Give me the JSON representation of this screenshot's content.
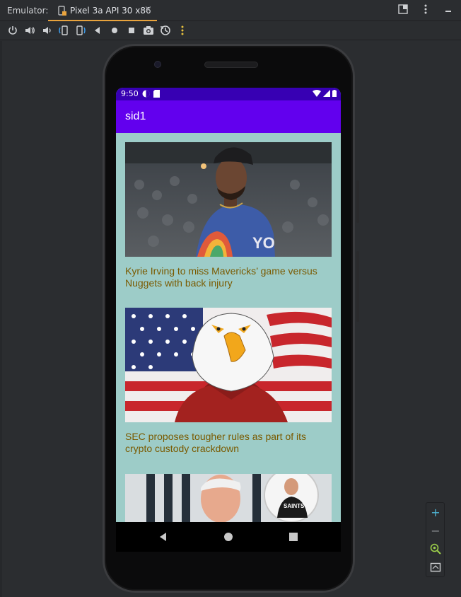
{
  "ide": {
    "emulator_label": "Emulator:",
    "tab_label": "Pixel 3a API 30 x86",
    "tab_close": "×",
    "accent_color": "#e8a33d"
  },
  "toolbar": {
    "icons": [
      "power-icon",
      "volume-up-icon",
      "volume-down-icon",
      "rotate-left-icon",
      "rotate-right-icon",
      "back-icon",
      "home-icon",
      "overview-icon",
      "screenshot-icon",
      "snapshot-icon",
      "more-icon"
    ]
  },
  "device": {
    "status_time": "9:50",
    "app_title": "sid1",
    "statusbar_color": "#3700b3",
    "appbar_color": "#6200ee",
    "background_color": "#9dccc8",
    "title_color": "#7a5a00"
  },
  "feed": {
    "items": [
      {
        "title": "Kyrie Irving to miss Mavericks’ game versus Nuggets with back injury",
        "image": "basketball-player-photo"
      },
      {
        "title": "SEC proposes tougher rules as part of its crypto custody crackdown",
        "image": "eagle-flag-illustration"
      },
      {
        "title": "",
        "image": "coach-photo"
      }
    ]
  },
  "zoom": {
    "plus": "+",
    "minus": "−"
  }
}
